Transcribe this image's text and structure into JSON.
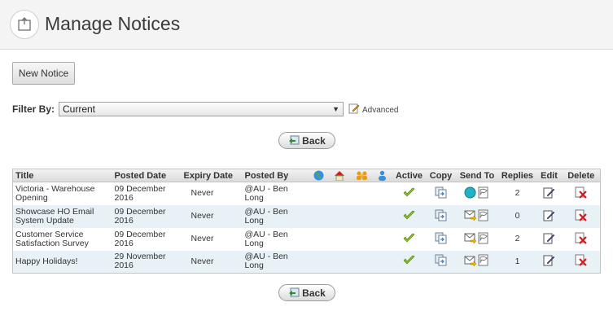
{
  "header": {
    "title": "Manage Notices"
  },
  "toolbar": {
    "new_notice_label": "New Notice"
  },
  "filter": {
    "label": "Filter By:",
    "selected": "Current",
    "advanced_label": "Advanced"
  },
  "back_label": "Back",
  "table": {
    "headers": {
      "title": "Title",
      "posted_date": "Posted Date",
      "expiry_date": "Expiry Date",
      "posted_by": "Posted By",
      "active": "Active",
      "copy": "Copy",
      "send_to": "Send To",
      "replies": "Replies",
      "edit": "Edit",
      "delete": "Delete"
    },
    "rows": [
      {
        "title": "Victoria - Warehouse Opening",
        "posted_date": "09 December 2016",
        "expiry_date": "Never",
        "posted_by": "@AU - Ben Long",
        "replies": "2",
        "send_icon": "circle"
      },
      {
        "title": "Showcase HO Email System Update",
        "posted_date": "09 December 2016",
        "expiry_date": "Never",
        "posted_by": "@AU - Ben Long",
        "replies": "0",
        "send_icon": "email"
      },
      {
        "title": "Customer Service Satisfaction Survey",
        "posted_date": "09 December 2016",
        "expiry_date": "Never",
        "posted_by": "@AU - Ben Long",
        "replies": "2",
        "send_icon": "email"
      },
      {
        "title": "Happy Holidays!",
        "posted_date": "29 November 2016",
        "expiry_date": "Never",
        "posted_by": "@AU - Ben Long",
        "replies": "1",
        "send_icon": "email"
      }
    ]
  }
}
